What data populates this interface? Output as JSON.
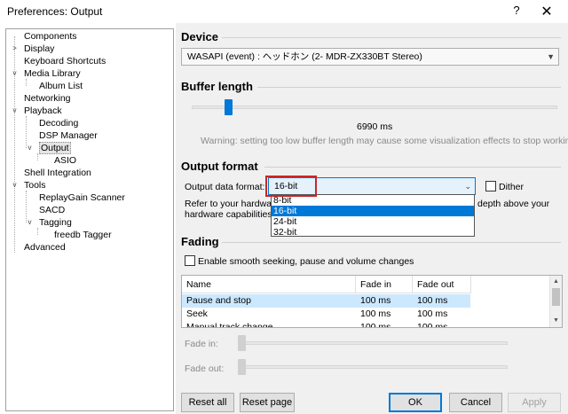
{
  "window": {
    "title": "Preferences: Output",
    "help": "?",
    "close": "✕"
  },
  "tree": {
    "items": [
      {
        "label": "Components"
      },
      {
        "label": "Display"
      },
      {
        "label": "Keyboard Shortcuts"
      },
      {
        "label": "Media Library"
      },
      {
        "label": "Album List"
      },
      {
        "label": "Networking"
      },
      {
        "label": "Playback"
      },
      {
        "label": "Decoding"
      },
      {
        "label": "DSP Manager"
      },
      {
        "label": "Output"
      },
      {
        "label": "ASIO"
      },
      {
        "label": "Shell Integration"
      },
      {
        "label": "Tools"
      },
      {
        "label": "ReplayGain Scanner"
      },
      {
        "label": "SACD"
      },
      {
        "label": "Tagging"
      },
      {
        "label": "freedb Tagger"
      },
      {
        "label": "Advanced"
      }
    ],
    "selected": "Output"
  },
  "device": {
    "heading": "Device",
    "value": "WASAPI (event) : ヘッドホン (2- MDR-ZX330BT Stereo)"
  },
  "buffer": {
    "heading": "Buffer length",
    "value_label": "6990 ms",
    "level_fraction": 0.1,
    "warning": "Warning: setting too low buffer length may cause some visualization effects to stop working."
  },
  "output_format": {
    "heading": "Output format",
    "label": "Output data format:",
    "selected": "16-bit",
    "dither_label": "Dither",
    "refer_line1": "Refer to your hardware",
    "refer_line1_tail": "depth above your",
    "refer_line2": "hardware capabilities w",
    "options": [
      "8-bit",
      "16-bit",
      "24-bit",
      "32-bit"
    ],
    "highlighted": "16-bit"
  },
  "fading": {
    "heading": "Fading",
    "checkbox_label": "Enable smooth seeking, pause and volume changes",
    "columns": [
      "Name",
      "Fade in",
      "Fade out"
    ],
    "rows": [
      {
        "name": "Pause and stop",
        "fade_in": "100 ms",
        "fade_out": "100 ms"
      },
      {
        "name": "Seek",
        "fade_in": "100 ms",
        "fade_out": "100 ms"
      },
      {
        "name": "Manual track change",
        "fade_in": "100 ms",
        "fade_out": "100 ms"
      }
    ],
    "fade_in_label": "Fade in:",
    "fade_out_label": "Fade out:"
  },
  "buttons": {
    "reset_all": "Reset all",
    "reset_page": "Reset page",
    "ok": "OK",
    "cancel": "Cancel",
    "apply": "Apply"
  }
}
